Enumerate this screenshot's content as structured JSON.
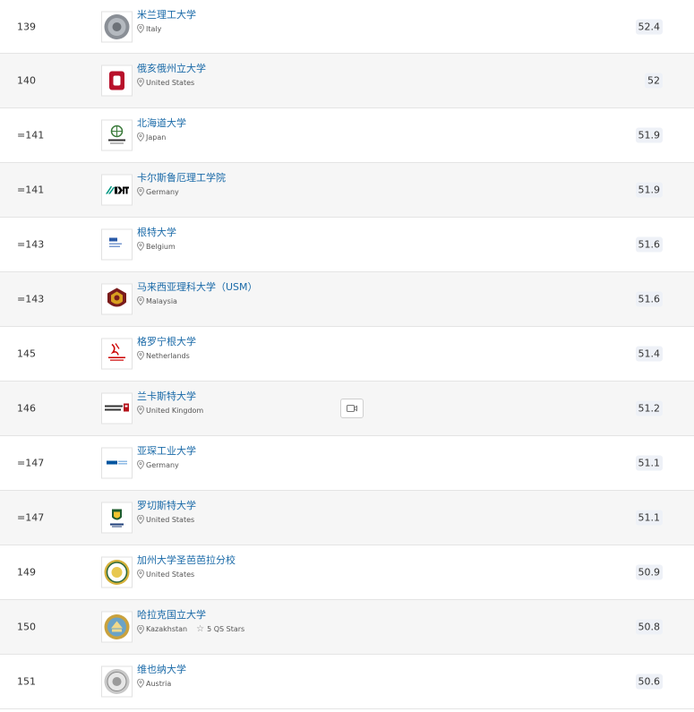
{
  "rows": [
    {
      "rank": "139",
      "name": "米兰理工大学",
      "country": "Italy",
      "score": "52.4",
      "logo": "politecnico-milano-seal-logo",
      "shade": false
    },
    {
      "rank": "140",
      "name": "俄亥俄州立大学",
      "country": "United States",
      "score": "52",
      "logo": "ohio-state-o-logo",
      "shade": true
    },
    {
      "rank": "=141",
      "name": "北海道大学",
      "country": "Japan",
      "score": "51.9",
      "logo": "hokkaido-logo",
      "shade": false
    },
    {
      "rank": "=141",
      "name": "卡尔斯鲁厄理工学院",
      "country": "Germany",
      "score": "51.9",
      "logo": "kit-logo",
      "shade": true
    },
    {
      "rank": "=143",
      "name": "根特大学",
      "country": "Belgium",
      "score": "51.6",
      "logo": "ghent-logo",
      "shade": false
    },
    {
      "rank": "=143",
      "name": "马来西亚理科大学（USM）",
      "country": "Malaysia",
      "score": "51.6",
      "logo": "usm-crest-logo",
      "shade": true
    },
    {
      "rank": "145",
      "name": "格罗宁根大学",
      "country": "Netherlands",
      "score": "51.4",
      "logo": "groningen-logo",
      "shade": false
    },
    {
      "rank": "146",
      "name": "兰卡斯特大学",
      "country": "United Kingdom",
      "score": "51.2",
      "logo": "lancaster-logo",
      "shade": true,
      "video": true
    },
    {
      "rank": "=147",
      "name": "亚琛工业大学",
      "country": "Germany",
      "score": "51.1",
      "logo": "rwth-logo",
      "shade": false
    },
    {
      "rank": "=147",
      "name": "罗切斯特大学",
      "country": "United States",
      "score": "51.1",
      "logo": "rochester-logo",
      "shade": true
    },
    {
      "rank": "149",
      "name": "加州大学圣芭芭拉分校",
      "country": "United States",
      "score": "50.9",
      "logo": "ucsb-seal-logo",
      "shade": false
    },
    {
      "rank": "150",
      "name": "哈拉克国立大学",
      "country": "Kazakhstan",
      "score": "50.8",
      "logo": "kaznu-seal-logo",
      "shade": true,
      "stars": "5 QS Stars"
    },
    {
      "rank": "151",
      "name": "维也纳大学",
      "country": "Austria",
      "score": "50.6",
      "logo": "vienna-seal-logo",
      "shade": false
    }
  ],
  "colors": {
    "link": "#1a6aa8",
    "shade": "#f6f6f6",
    "score_bg": "#eef1f7"
  }
}
